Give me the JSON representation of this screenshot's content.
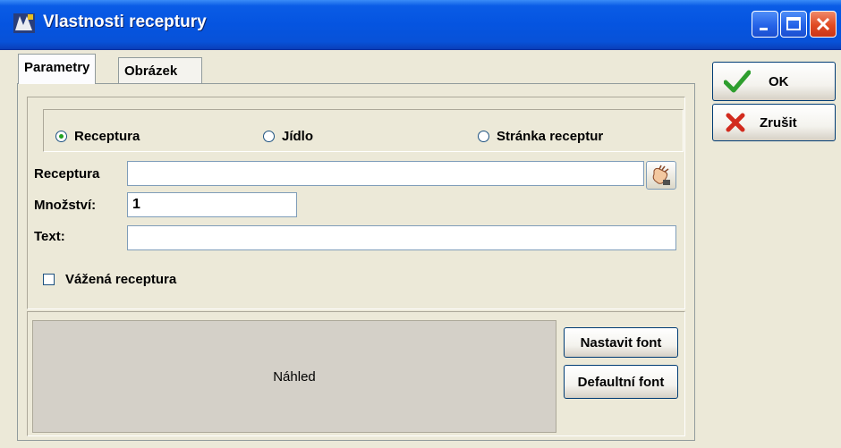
{
  "window": {
    "title": "Vlastnosti receptury",
    "buttons": [
      "minimize",
      "maximize",
      "close"
    ]
  },
  "tabs": [
    {
      "label": "Parametry",
      "active": true
    },
    {
      "label": "Obrázek",
      "active": false
    }
  ],
  "radio_options": [
    {
      "label": "Receptura",
      "checked": true
    },
    {
      "label": "Jídlo",
      "checked": false
    },
    {
      "label": "Stránka receptur",
      "checked": false
    }
  ],
  "fields": {
    "receptura": {
      "label": "Receptura",
      "value": ""
    },
    "mnozstvi": {
      "label": "Množství:",
      "value": "1"
    },
    "text": {
      "label": "Text:",
      "value": ""
    }
  },
  "checkbox": {
    "label": "Vážená receptura",
    "checked": false
  },
  "preview": {
    "label": "Náhled"
  },
  "font_buttons": {
    "set_font": "Nastavit font",
    "default_font": "Defaultní font"
  },
  "actions": {
    "ok": "OK",
    "cancel": "Zrušit"
  },
  "icons": [
    "app-icon",
    "hand-icon",
    "check-icon",
    "cross-icon"
  ],
  "colors": {
    "titlebar": "#0554e0",
    "ok_icon": "#2e9e2e",
    "cancel_icon": "#d22b1e"
  }
}
